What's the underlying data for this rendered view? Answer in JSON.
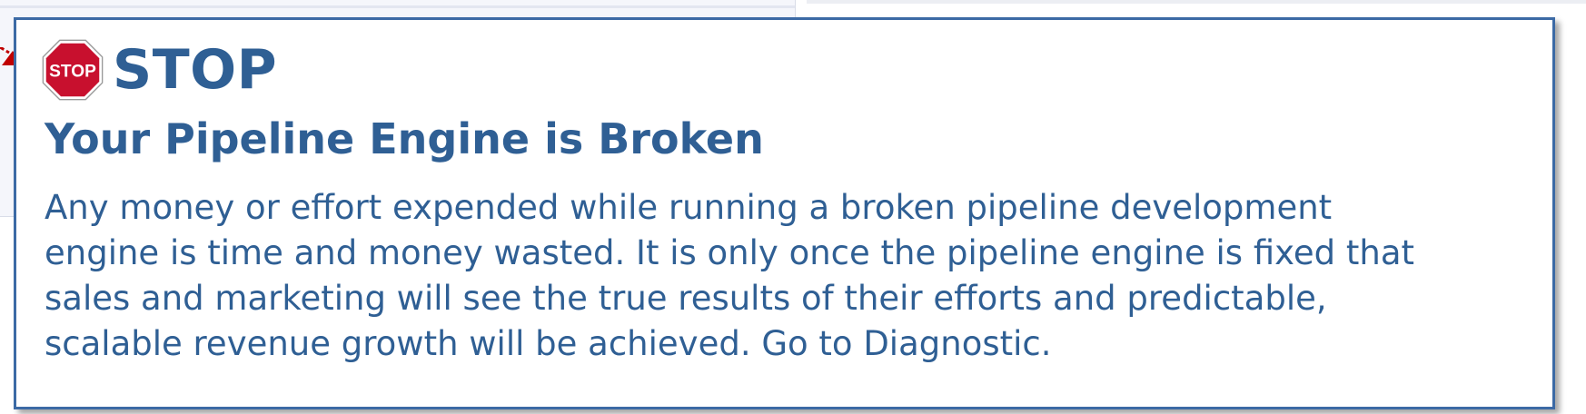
{
  "popup": {
    "stop_label": "STOP",
    "title": "Your Pipeline Engine is Broken",
    "body_lines": [
      "Any money or effort expended while running a broken pipeline development",
      "engine is time and money wasted.  It is only once the pipeline engine is fixed that",
      "sales and marketing will see the true results of their efforts and predictable,",
      "scalable revenue growth will be achieved.  Go to Diagnostic."
    ],
    "icon": "stop-sign-icon",
    "stop_sign_text": "STOP"
  },
  "colors": {
    "text": "#2f5f94",
    "border": "#3c6aa5",
    "stop_sign": "#c8102e",
    "arrow": "#c00000"
  }
}
